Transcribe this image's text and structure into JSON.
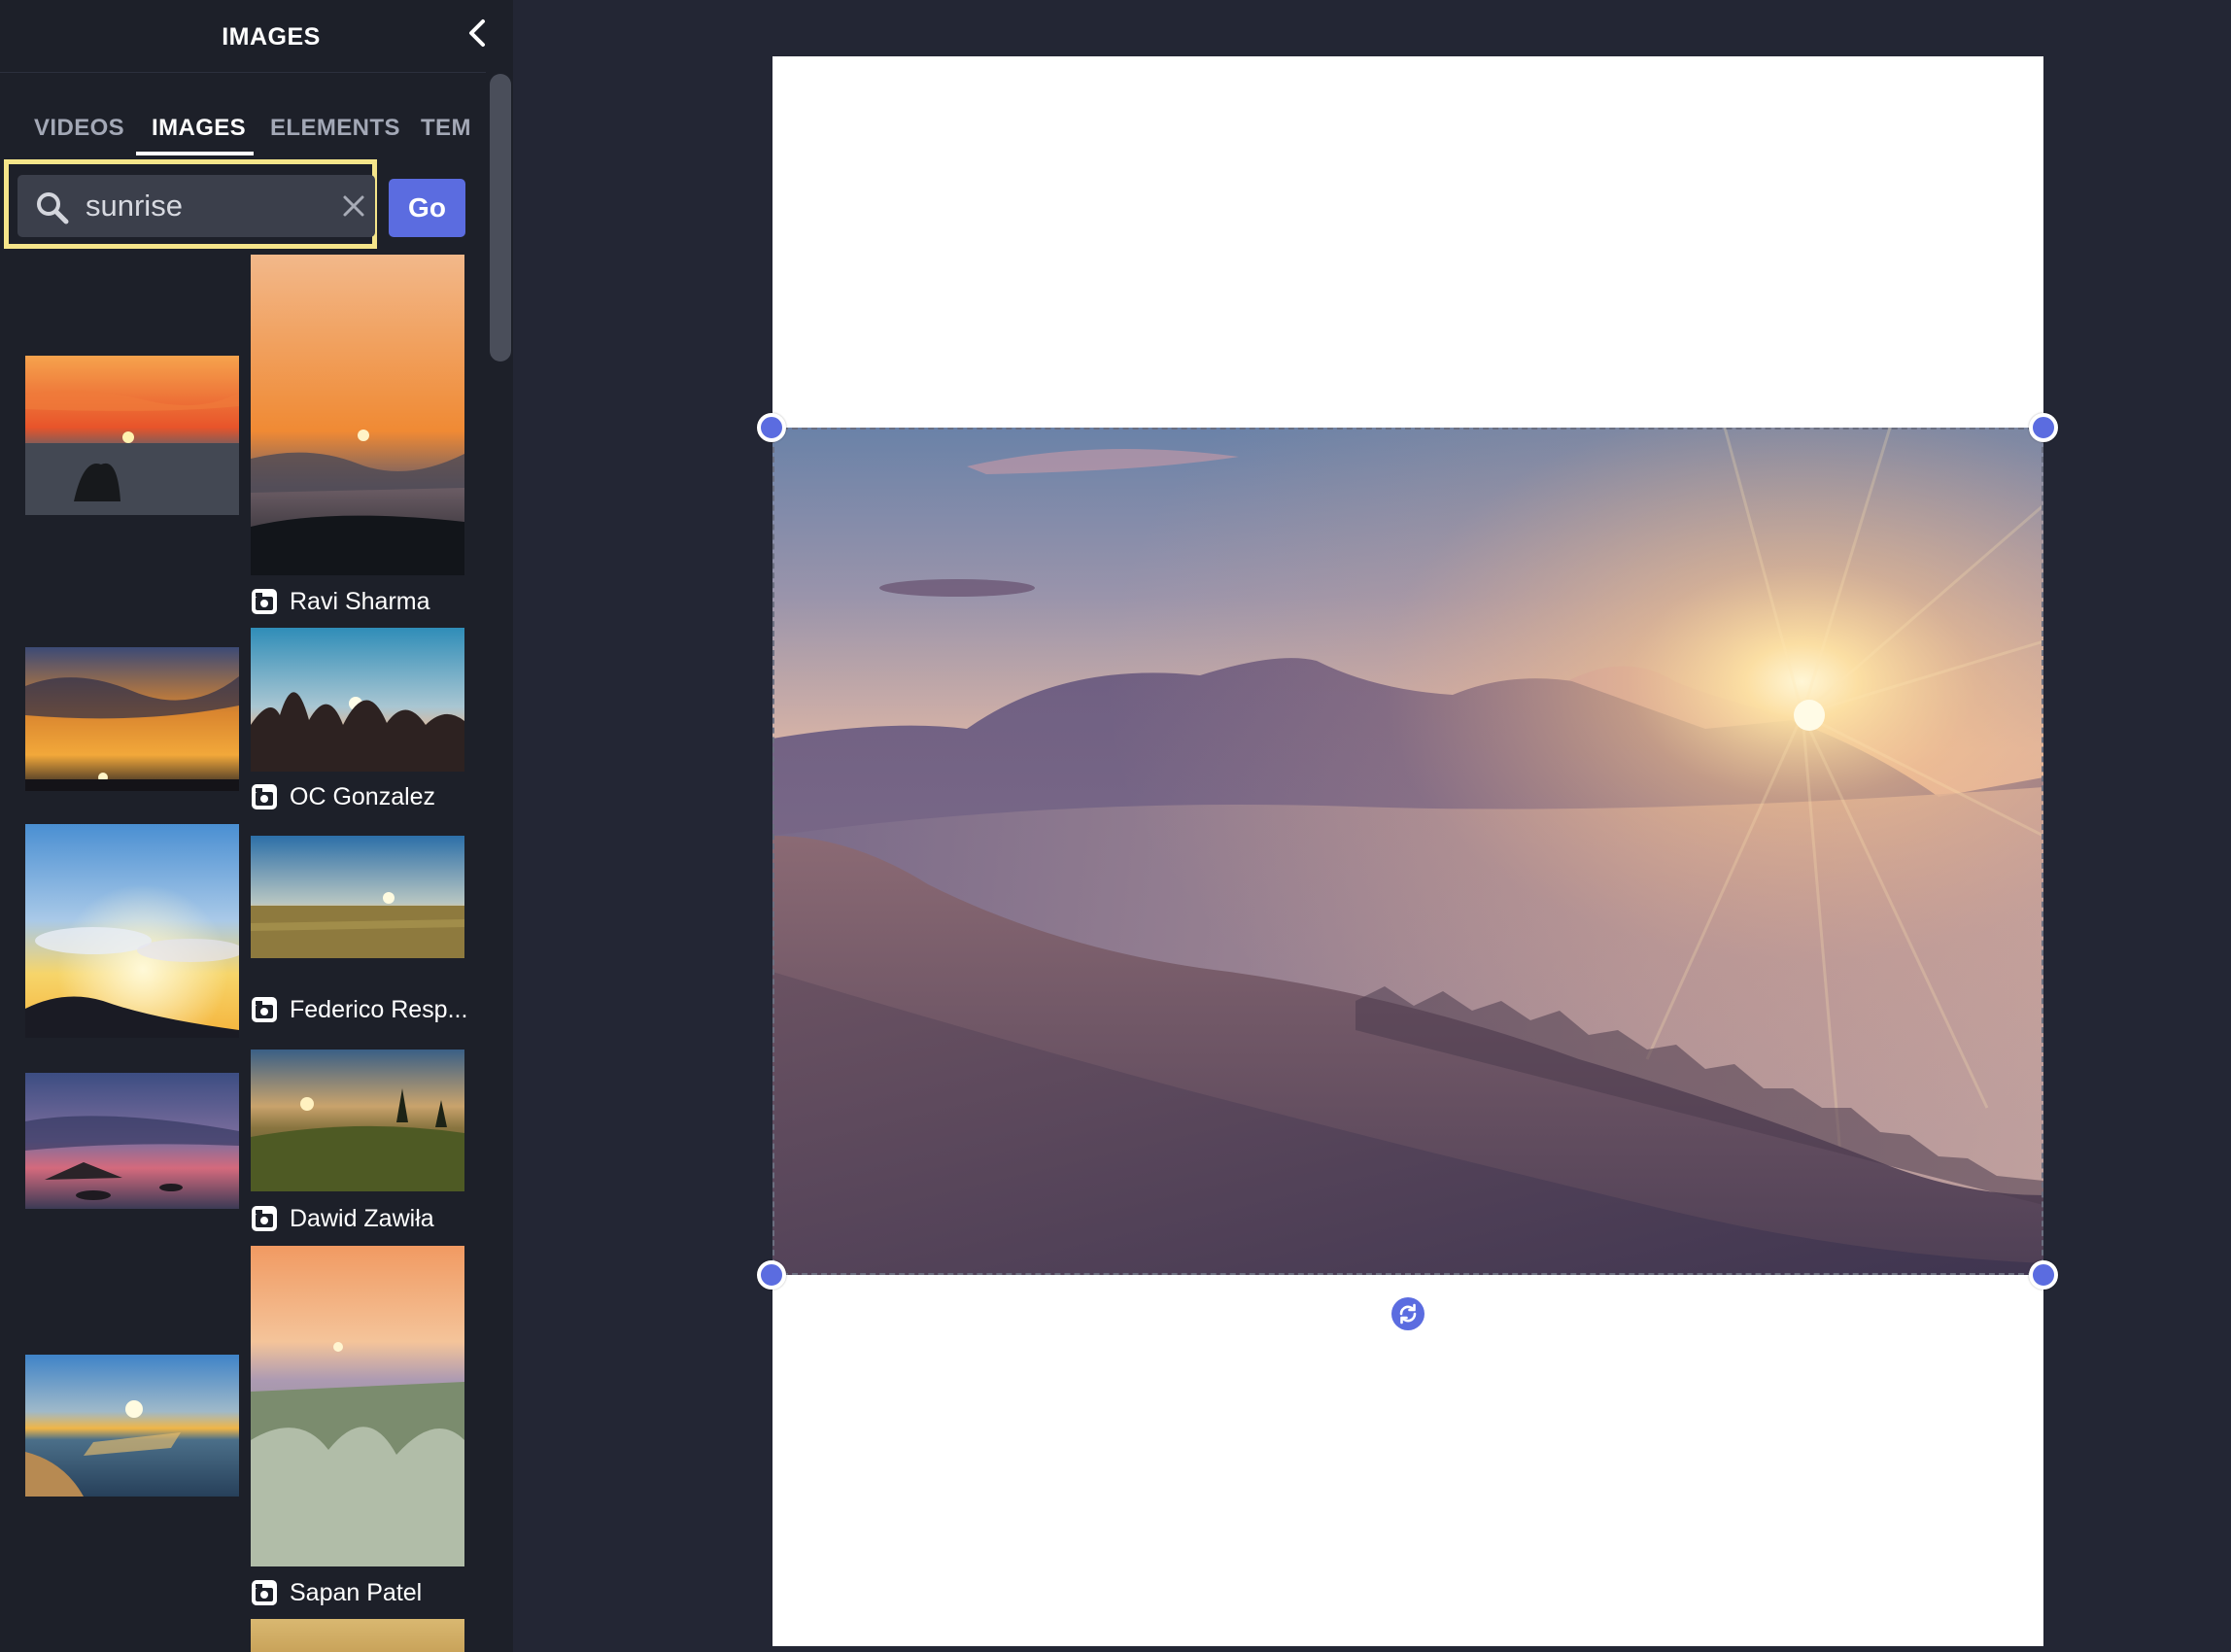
{
  "panel": {
    "title": "IMAGES"
  },
  "tabs": [
    {
      "label": "VIDEOS",
      "active": false
    },
    {
      "label": "IMAGES",
      "active": true
    },
    {
      "label": "ELEMENTS",
      "active": false
    },
    {
      "label": "TEM",
      "active": false
    }
  ],
  "search": {
    "query": "sunrise",
    "go_label": "Go"
  },
  "results": {
    "credits": [
      "Ravi Sharma",
      "OC Gonzalez",
      "Federico Resp...",
      "Dawid Zawiła",
      "Sapan Patel"
    ]
  },
  "colors": {
    "accent": "#5b6ce0",
    "sidebar_bg": "#1d2029",
    "workspace_bg": "#232634",
    "search_highlight": "#f5e58a"
  },
  "icons": {
    "collapse": "chevron-left-icon",
    "search": "search-icon",
    "clear": "close-icon",
    "credit": "camera-icon",
    "rotate": "rotate-icon"
  }
}
